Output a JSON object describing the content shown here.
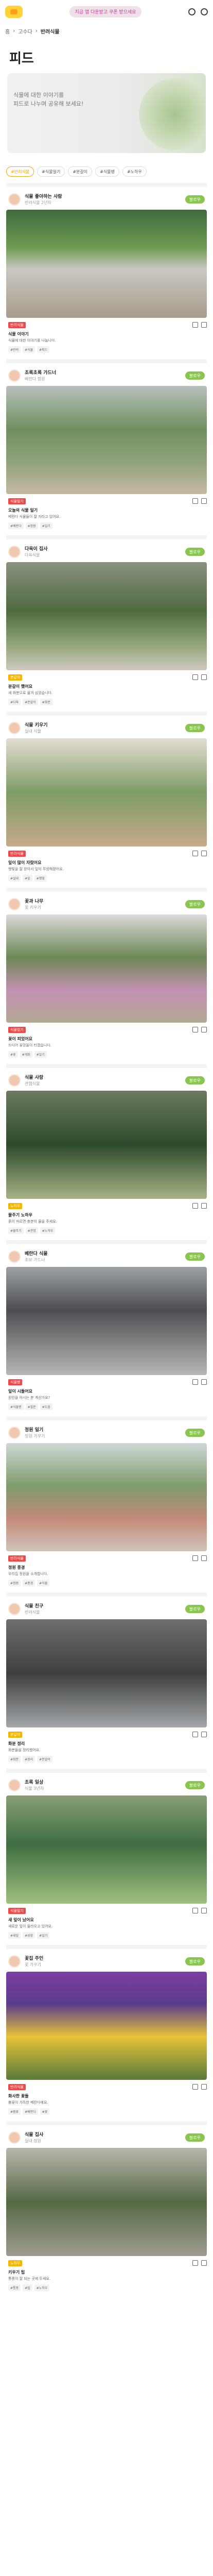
{
  "header": {
    "promo": "지금 앱 다운받고 쿠폰 받으세요"
  },
  "breadcrumb": {
    "home": "홈",
    "level1": "고수다",
    "level2": "반려식물"
  },
  "page": {
    "title": "피드"
  },
  "banner": {
    "line1": "식물에 대한 이야기를",
    "line2": "피드로 나누며 공유해 보세요!"
  },
  "filters": [
    "#반려식물",
    "#식물일기",
    "#분갈이",
    "#식물병",
    "#노하우"
  ],
  "follow_label": "팔로우",
  "posts": [
    {
      "user": "식물 좋아하는 사람",
      "sub": "반려식물 2년차",
      "tag": "반려식물",
      "title": "식물 이야기",
      "body": "식물에 대한 이야기를 나눕니다.",
      "kw": [
        "#반려",
        "#식물",
        "#피드"
      ]
    },
    {
      "user": "초록초록 가드너",
      "sub": "베란다 정원",
      "tag": "식물일기",
      "title": "오늘의 식물 일기",
      "body": "베란다 식물들이 잘 자라고 있어요.",
      "kw": [
        "#베란다",
        "#정원",
        "#일기"
      ]
    },
    {
      "user": "다육이 집사",
      "sub": "다육식물",
      "tag": "분갈이",
      "title": "분갈이 했어요",
      "body": "새 화분으로 옮겨 심었습니다.",
      "kw": [
        "#다육",
        "#분갈이",
        "#화분"
      ]
    },
    {
      "user": "식물 키우기",
      "sub": "실내 식물",
      "tag": "반려식물",
      "title": "잎이 많이 자랐어요",
      "body": "햇빛을 잘 받아서 잎이 무성해졌어요.",
      "kw": [
        "#실내",
        "#잎",
        "#햇빛"
      ]
    },
    {
      "user": "꽃과 나무",
      "sub": "꽃 키우기",
      "tag": "식물일기",
      "title": "꽃이 피었어요",
      "body": "드디어 꽃망울이 터졌습니다.",
      "kw": [
        "#꽃",
        "#개화",
        "#일기"
      ]
    },
    {
      "user": "식물 사랑",
      "sub": "관엽식물",
      "tag": "노하우",
      "title": "물주기 노하우",
      "body": "흙이 마르면 충분히 물을 주세요.",
      "kw": [
        "#물주기",
        "#관엽",
        "#노하우"
      ]
    },
    {
      "user": "베란다 식물",
      "sub": "초보 가드너",
      "tag": "식물병",
      "title": "잎이 시들어요",
      "body": "원인을 아시는 분 계신가요?",
      "kw": [
        "#식물병",
        "#질문",
        "#도움"
      ]
    },
    {
      "user": "정원 일기",
      "sub": "정원 가꾸기",
      "tag": "반려식물",
      "title": "정원 풍경",
      "body": "우리집 정원을 소개합니다.",
      "kw": [
        "#정원",
        "#풍경",
        "#식물"
      ]
    },
    {
      "user": "식물 친구",
      "sub": "반려식물",
      "tag": "분갈이",
      "title": "화분 정리",
      "body": "화분들을 정리했어요.",
      "kw": [
        "#화분",
        "#정리",
        "#분갈이"
      ]
    },
    {
      "user": "초록 일상",
      "sub": "식물 3년차",
      "tag": "식물일기",
      "title": "새 잎이 났어요",
      "body": "새로운 잎이 올라오고 있어요.",
      "kw": [
        "#새잎",
        "#성장",
        "#일기"
      ]
    },
    {
      "user": "꽃집 주인",
      "sub": "꽃 가꾸기",
      "tag": "반려식물",
      "title": "화사한 꽃들",
      "body": "봄꽃이 가득한 베란다예요.",
      "kw": [
        "#봄꽃",
        "#베란다",
        "#꽃"
      ]
    },
    {
      "user": "식물 집사",
      "sub": "실내 정원",
      "tag": "노하우",
      "title": "키우기 팁",
      "body": "통풍이 잘 되는 곳에 두세요.",
      "kw": [
        "#통풍",
        "#팁",
        "#노하우"
      ]
    }
  ]
}
